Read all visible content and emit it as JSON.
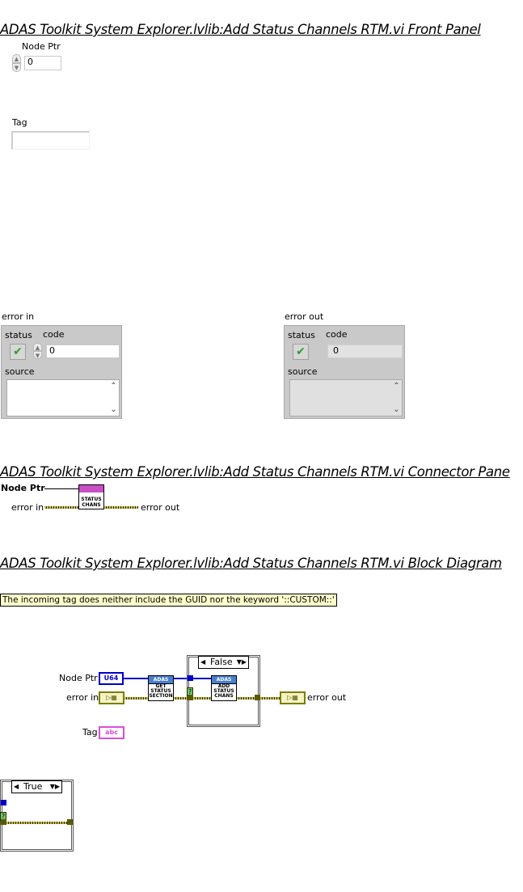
{
  "front_panel": {
    "heading": "ADAS Toolkit System Explorer.lvlib:Add Status Channels RTM.vi Front Panel",
    "node_ptr": {
      "label": "Node Ptr",
      "value": "0"
    },
    "tag": {
      "label": "Tag",
      "value": ""
    },
    "error_in": {
      "label": "error in",
      "status_label": "status",
      "code_label": "code",
      "code_value": "0",
      "source_label": "source",
      "source_value": ""
    },
    "error_out": {
      "label": "error out",
      "status_label": "status",
      "code_label": "code",
      "code_value": "0",
      "source_label": "source",
      "source_value": ""
    }
  },
  "connector_pane": {
    "heading": "ADAS Toolkit System Explorer.lvlib:Add Status Channels RTM.vi Connector Pane",
    "node_ptr": "Node Ptr",
    "error_in": "error in",
    "error_out": "error out",
    "icon_line1": "STATUS",
    "icon_line2": "CHANS"
  },
  "block_diagram": {
    "heading": "ADAS Toolkit System Explorer.lvlib:Add Status Channels RTM.vi Block Diagram",
    "comment": "The incoming tag does neither include the GUID nor the keyword '::CUSTOM::'",
    "node_ptr_label": "Node Ptr",
    "u64_text": "U64",
    "error_in_label": "error in",
    "error_out_label": "error out",
    "tag_label": "Tag",
    "str_text": "abc",
    "subvi_get": {
      "hdr": "ADAS",
      "l1": "GET",
      "l2": "STATUS",
      "l3": "SECTION"
    },
    "subvi_add": {
      "hdr": "ADAS",
      "l1": "ADD",
      "l2": "STATUS",
      "l3": "CHANS"
    },
    "case_false": "False",
    "case_true": "True",
    "q_mark": "?"
  }
}
